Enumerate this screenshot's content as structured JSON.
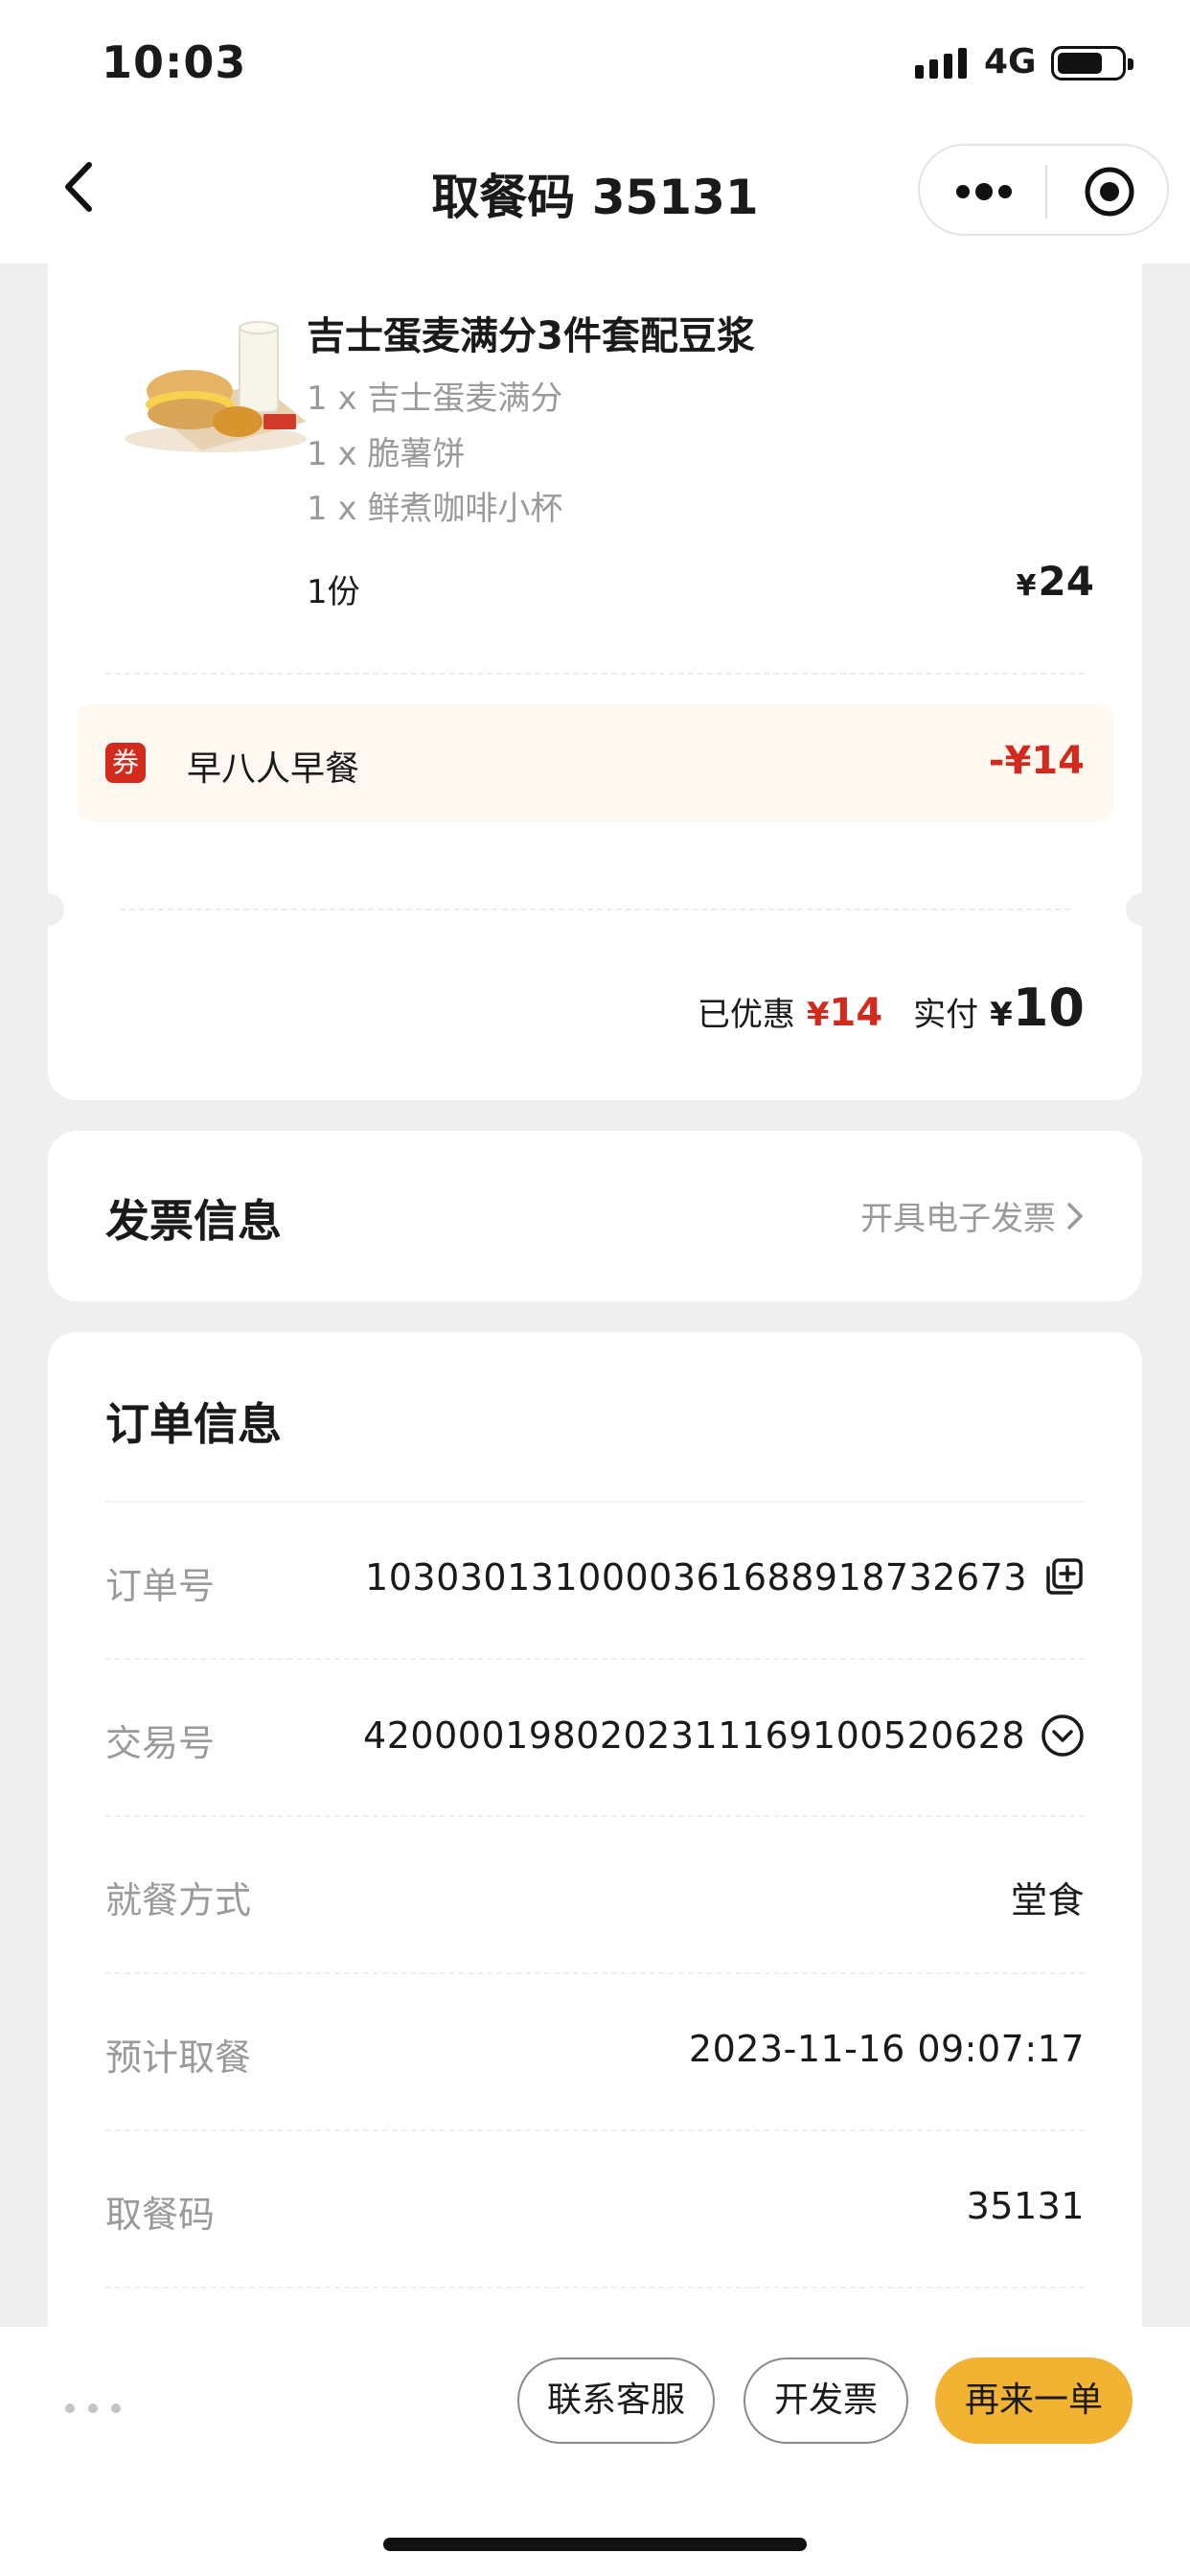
{
  "status_bar": {
    "time": "10:03",
    "network": "4G"
  },
  "nav": {
    "title": "取餐码 35131"
  },
  "order_item": {
    "name": "吉士蛋麦满分3件套配豆浆",
    "sub_items": [
      "1 x 吉士蛋麦满分",
      "1 x 脆薯饼",
      "1 x 鲜煮咖啡小杯"
    ],
    "quantity": "1份",
    "currency": "¥",
    "price": "24"
  },
  "coupon": {
    "tag": "券",
    "name": "早八人早餐",
    "amount": "-¥14"
  },
  "summary": {
    "discount_label": "已优惠",
    "discount_currency": "¥",
    "discount_value": "14",
    "paid_label": "实付",
    "paid_currency": "¥",
    "paid_value": "10"
  },
  "invoice": {
    "title": "发票信息",
    "link": "开具电子发票"
  },
  "order_info": {
    "title": "订单信息",
    "rows": [
      {
        "label": "订单号",
        "value": "10303013100003616889 18732673",
        "icon": "copy-icon"
      },
      {
        "label": "交易号",
        "value": "4200001980202311169100520628",
        "icon": "expand-circle-icon"
      },
      {
        "label": "就餐方式",
        "value": "堂食"
      },
      {
        "label": "预计取餐",
        "value": "2023-11-16 09:07:17"
      },
      {
        "label": "取餐码",
        "value": "35131"
      }
    ]
  },
  "bottom_bar": {
    "contact": "联系客服",
    "invoice": "开发票",
    "reorder": "再来一单"
  },
  "colors": {
    "accent_red": "#d22b1e",
    "primary_yellow": "#f2b232",
    "background": "#efefef"
  }
}
